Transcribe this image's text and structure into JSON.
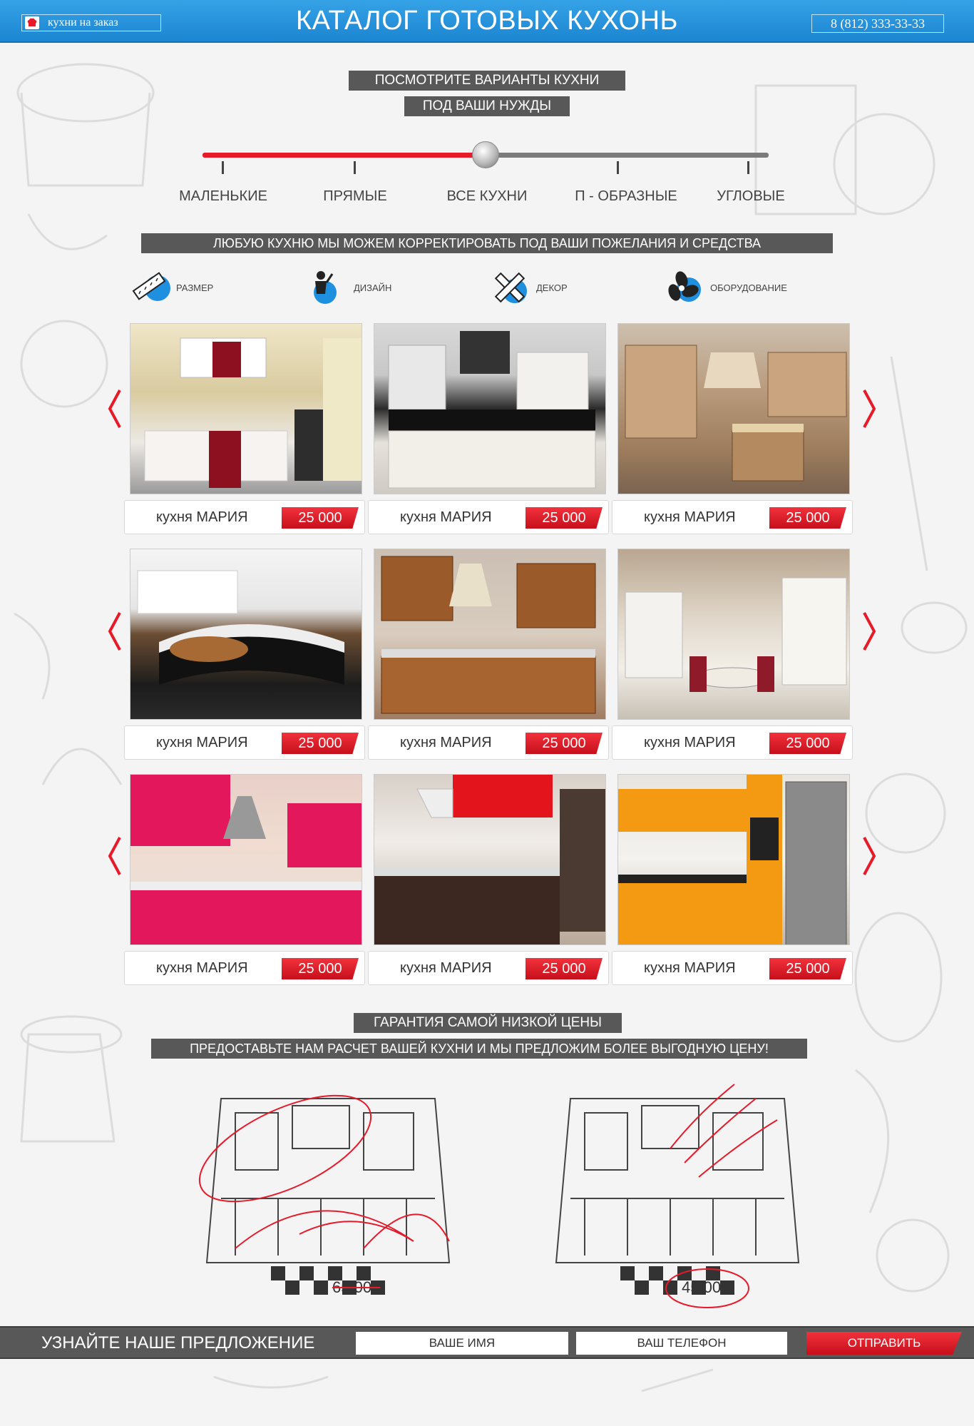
{
  "header": {
    "logo_text": "кухни на заказ",
    "title": "КАТАЛОГ ГОТОВЫХ КУХОНЬ",
    "phone": "8 (812) 333-33-33"
  },
  "intro": {
    "line1": "ПОСМОТРИТЕ ВАРИАНТЫ КУХНИ",
    "line2": "ПОД ВАШИ НУЖДЫ"
  },
  "filter": {
    "options": [
      "МАЛЕНЬКИЕ",
      "ПРЯМЫЕ",
      "ВСЕ КУХНИ",
      "П - ОБРАЗНЫЕ",
      "УГЛОВЫЕ"
    ],
    "selected": "ВСЕ КУХНИ",
    "position_fraction": 0.5,
    "active_color": "#e71a2a"
  },
  "custom_banner": "ЛЮБУЮ КУХНЮ МЫ МОЖЕМ КОРРЕКТИРОВАТЬ  ПОД ВАШИ ПОЖЕЛАНИЯ И СРЕДСТВА",
  "features": [
    {
      "icon": "ruler-icon",
      "label": "РАЗМЕР"
    },
    {
      "icon": "designer-icon",
      "label": "ДИЗАЙН"
    },
    {
      "icon": "pencil-ruler-icon",
      "label": "ДЕКОР"
    },
    {
      "icon": "fan-icon",
      "label": "ОБОРУДОВАНИЕ"
    }
  ],
  "products": [
    {
      "name": "кухня МАРИЯ",
      "price": "25 000"
    },
    {
      "name": "кухня МАРИЯ",
      "price": "25 000"
    },
    {
      "name": "кухня МАРИЯ",
      "price": "25 000"
    },
    {
      "name": "кухня МАРИЯ",
      "price": "25 000"
    },
    {
      "name": "кухня МАРИЯ",
      "price": "25 000"
    },
    {
      "name": "кухня МАРИЯ",
      "price": "25 000"
    },
    {
      "name": "кухня МАРИЯ",
      "price": "25 000"
    },
    {
      "name": "кухня МАРИЯ",
      "price": "25 000"
    },
    {
      "name": "кухня МАРИЯ",
      "price": "25 000"
    }
  ],
  "guarantee": {
    "title": "ГАРАНТИЯ САМОЙ НИЗКОЙ ЦЕНЫ",
    "subtitle": "ПРЕДОСТАВЬТЕ НАМ РАСЧЕТ ВАШЕЙ КУХНИ И МЫ ПРЕДЛОЖИМ БОЛЕЕ ВЫГОДНУЮ ЦЕНУ!",
    "old_price": "65 000",
    "new_price": "45 000"
  },
  "form": {
    "title": "УЗНАЙТЕ НАШЕ ПРЕДЛОЖЕНИЕ",
    "name_placeholder": "ВАШЕ ИМЯ",
    "phone_placeholder": "ВАШ ТЕЛЕФОН",
    "submit_label": "ОТПРАВИТЬ"
  },
  "colors": {
    "header_blue": "#1c86d2",
    "accent_red": "#e71a2a",
    "label_gray": "#585858",
    "icon_blue": "#1f8fe0"
  }
}
